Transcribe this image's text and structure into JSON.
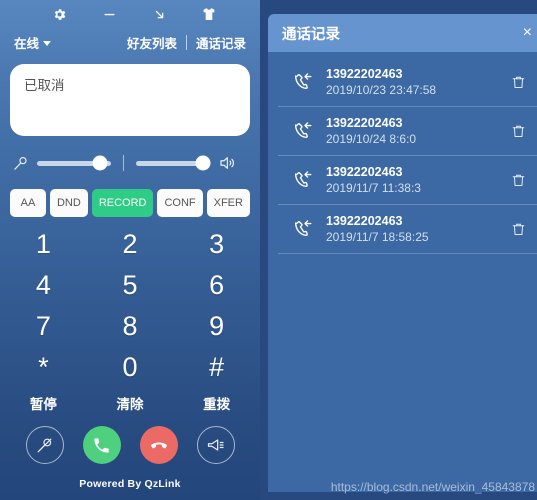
{
  "softphone": {
    "titlebar": {
      "icons": [
        {
          "name": "settings-gear-icon",
          "label": "设置"
        },
        {
          "name": "minimize-icon",
          "label": "最小化"
        },
        {
          "name": "collapse-arrow-icon",
          "label": "收起"
        },
        {
          "name": "theme-shirt-icon",
          "label": "皮肤"
        }
      ]
    },
    "status": {
      "label": "在线"
    },
    "nav": {
      "contacts": "好友列表",
      "call_records": "通话记录"
    },
    "display": {
      "text": "已取消"
    },
    "sliders": {
      "mic": {
        "icon": "microphone-icon",
        "value": 85
      },
      "speaker": {
        "icon": "speaker-icon",
        "value": 90
      }
    },
    "feature_buttons": [
      {
        "label": "AA",
        "active": false
      },
      {
        "label": "DND",
        "active": false
      },
      {
        "label": "RECORD",
        "active": true
      },
      {
        "label": "CONF",
        "active": false
      },
      {
        "label": "XFER",
        "active": false
      }
    ],
    "keypad": [
      "1",
      "2",
      "3",
      "4",
      "5",
      "6",
      "7",
      "8",
      "9",
      "*",
      "0",
      "#"
    ],
    "key_actions": [
      {
        "label": "暂停"
      },
      {
        "label": "清除"
      },
      {
        "label": "重拨"
      }
    ],
    "action_buttons": [
      {
        "name": "mute-button",
        "icon": "microphone-muted-icon",
        "style": "outline"
      },
      {
        "name": "answer-call-button",
        "icon": "phone-icon",
        "style": "green"
      },
      {
        "name": "hangup-button",
        "icon": "phone-hangup-icon",
        "style": "red"
      },
      {
        "name": "speaker-button",
        "icon": "megaphone-icon",
        "style": "outline"
      }
    ],
    "footer": "Powered By QzLink"
  },
  "call_log": {
    "title": "通话记录",
    "close_label": "×",
    "entries": [
      {
        "number": "13922202463",
        "time": "2019/10/23 23:47:58",
        "direction": "incoming"
      },
      {
        "number": "13922202463",
        "time": "2019/10/24 8:6:0",
        "direction": "incoming"
      },
      {
        "number": "13922202463",
        "time": "2019/11/7 11:38:3",
        "direction": "incoming"
      },
      {
        "number": "13922202463",
        "time": "2019/11/7 18:58:25",
        "direction": "incoming"
      }
    ]
  },
  "watermark": "https://blog.csdn.net/weixin_45843878",
  "colors": {
    "panel_blue": "#3c69a4",
    "header_blue": "#6694ce",
    "record_green": "#2ecc86",
    "answer_green": "#4ed07f",
    "hangup_red": "#eb6a65"
  }
}
